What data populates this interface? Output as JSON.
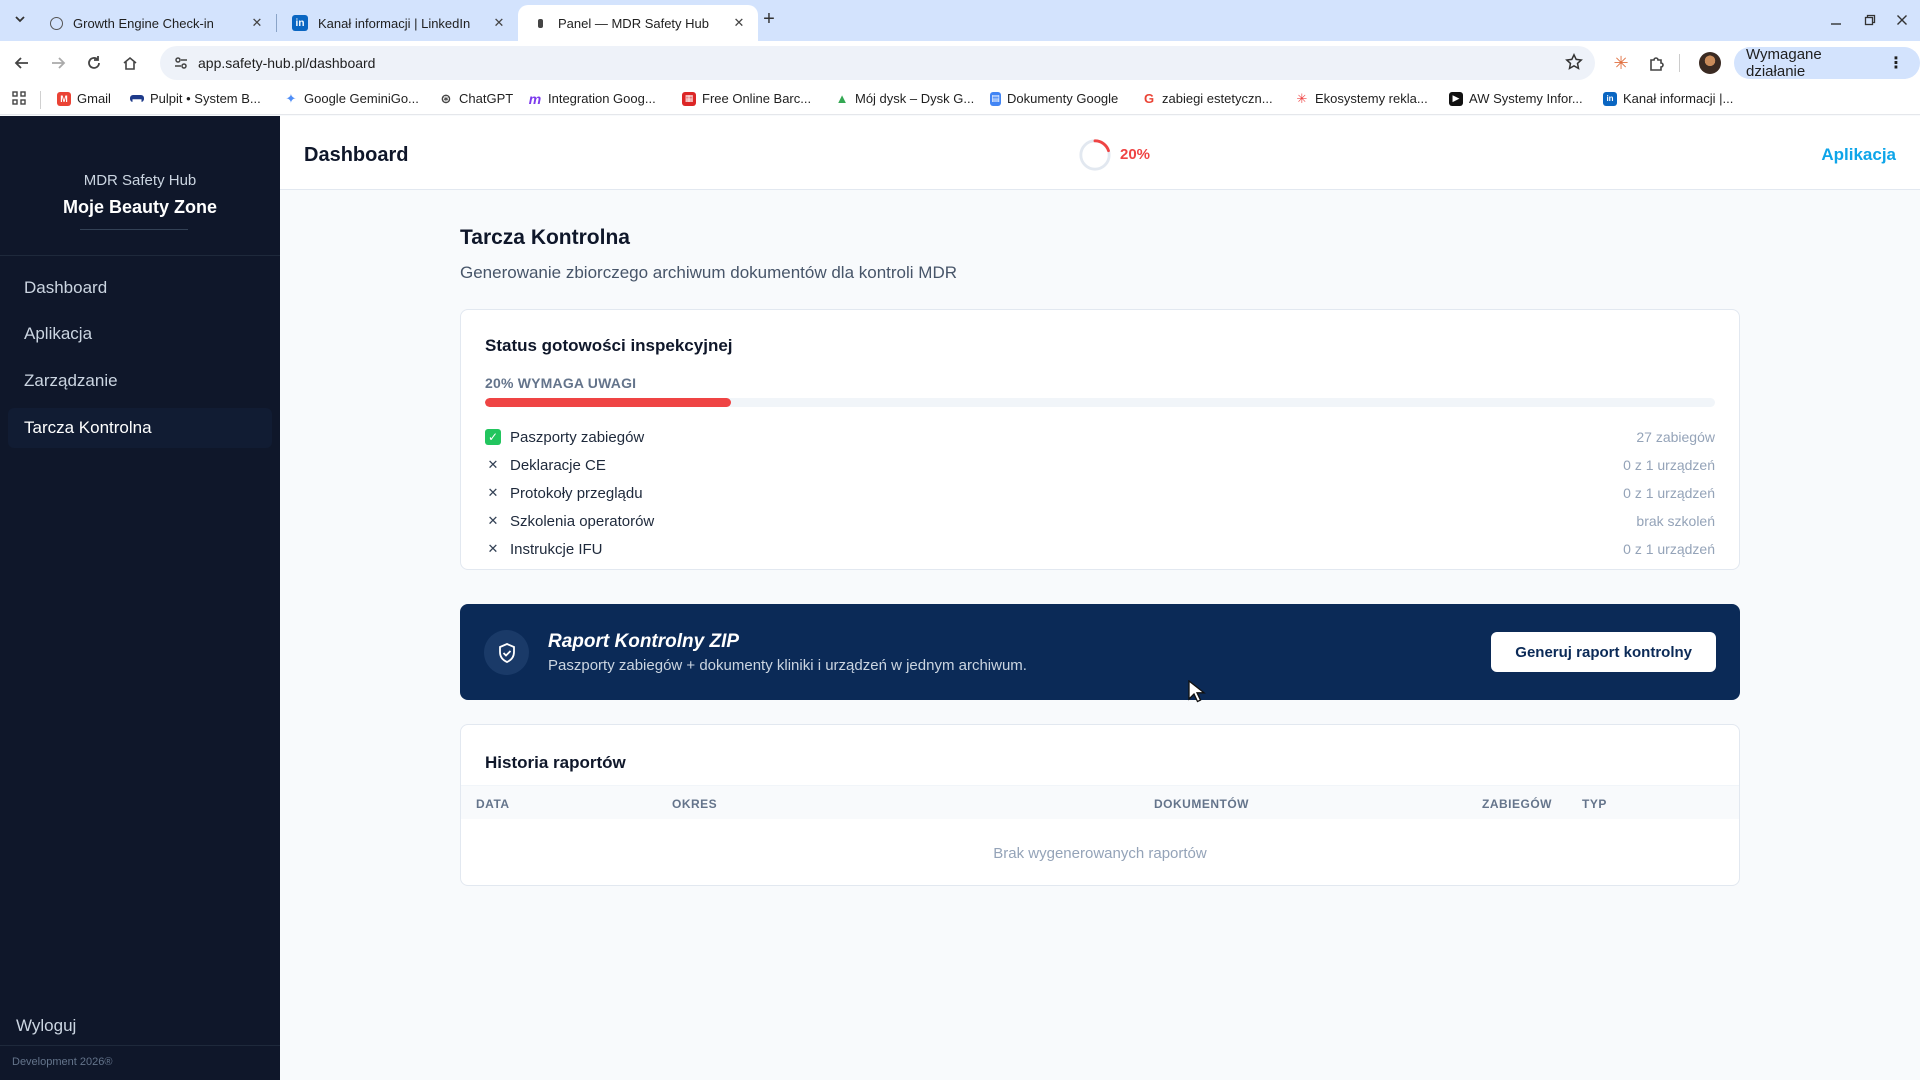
{
  "browser": {
    "tabs": [
      {
        "title": "Growth Engine Check-in",
        "icon": "globe-icon"
      },
      {
        "title": "Kanał informacji | LinkedIn",
        "icon": "linkedin-icon"
      },
      {
        "title": "Panel — MDR Safety Hub",
        "icon": "page-icon"
      }
    ],
    "url": "app.safety-hub.pl/dashboard",
    "action_required": "Wymagane działanie",
    "bookmarks": [
      {
        "label": "Gmail",
        "color": "#ea4335",
        "glyph": "M"
      },
      {
        "label": "Pulpit • System B...",
        "color": "#1e3a8a",
        "glyph": "▬"
      },
      {
        "label": "Google GeminiGo...",
        "color": "#4f8ef7",
        "glyph": "✦"
      },
      {
        "label": "ChatGPT",
        "color": "#444444",
        "glyph": "⊛"
      },
      {
        "label": "Integration Goog...",
        "color": "#7c3aed",
        "glyph": "m"
      },
      {
        "label": "Free Online Barc...",
        "color": "#dc2626",
        "glyph": "▦"
      },
      {
        "label": "Mój dysk – Dysk G...",
        "color": "#34a853",
        "glyph": "▲"
      },
      {
        "label": "Dokumenty Google",
        "color": "#4285f4",
        "glyph": "▤"
      },
      {
        "label": "zabiegi estetyczn...",
        "color": "#ea4335",
        "glyph": "G"
      },
      {
        "label": "Ekosystemy rekla...",
        "color": "#ef4444",
        "glyph": "✳"
      },
      {
        "label": "AW Systemy Infor...",
        "color": "#111111",
        "glyph": "▶"
      },
      {
        "label": "Kanał informacji |...",
        "color": "#0a66c2",
        "glyph": "in"
      }
    ]
  },
  "sidebar": {
    "app_name": "MDR Safety Hub",
    "org_name": "Moje Beauty Zone",
    "items": [
      {
        "label": "Dashboard"
      },
      {
        "label": "Aplikacja"
      },
      {
        "label": "Zarządzanie"
      },
      {
        "label": "Tarcza Kontrolna"
      }
    ],
    "logout": "Wyloguj",
    "footer": "Development 2026®"
  },
  "header": {
    "title": "Dashboard",
    "progress_label": "20%",
    "progress_value": 0.2,
    "app_link": "Aplikacja"
  },
  "page": {
    "title": "Tarcza Kontrolna",
    "subtitle": "Generowanie zbiorczego archiwum dokumentów dla kontroli MDR"
  },
  "status": {
    "title": "Status gotowości inspekcyjnej",
    "readiness_label": "20% WYMAGA UWAGI",
    "readiness_value": 0.2,
    "accent_color": "#ef4444",
    "items": [
      {
        "label": "Paszporty zabiegów",
        "value": "27 zabiegów",
        "ok": true
      },
      {
        "label": "Deklaracje CE",
        "value": "0 z 1 urządzeń",
        "ok": false
      },
      {
        "label": "Protokoły przeglądu",
        "value": "0 z 1 urządzeń",
        "ok": false
      },
      {
        "label": "Szkolenia operatorów",
        "value": "brak szkoleń",
        "ok": false
      },
      {
        "label": "Instrukcje IFU",
        "value": "0 z 1 urządzeń",
        "ok": false
      }
    ]
  },
  "zip": {
    "title": "Raport Kontrolny ZIP",
    "subtitle": "Paszporty zabiegów + dokumenty kliniki i urządzeń w jednym archiwum.",
    "button": "Generuj raport kontrolny"
  },
  "history": {
    "title": "Historia raportów",
    "columns": [
      "DATA",
      "OKRES",
      "DOKUMENTÓW",
      "ZABIEGÓW",
      "TYP"
    ],
    "empty": "Brak wygenerowanych raportów"
  }
}
